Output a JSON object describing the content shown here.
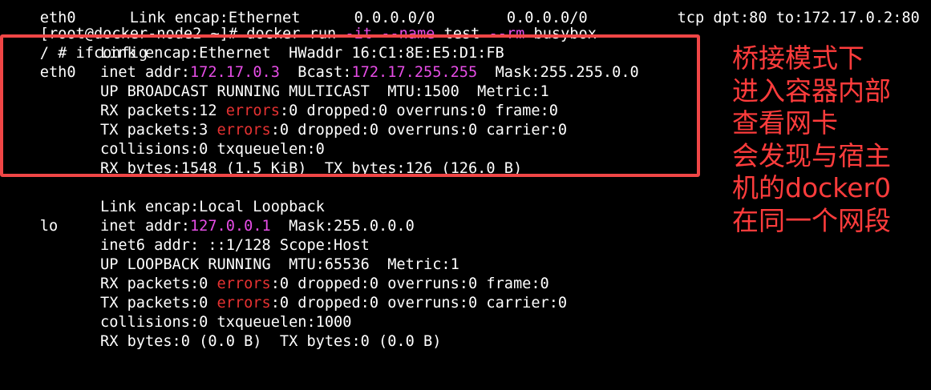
{
  "terminal": {
    "top_cut": "eth0      Link encap:Ethernet      0.0.0.0/0        0.0.0.0/0          tcp dpt:80 to:172.17.0.2:80",
    "prompt_line": {
      "prompt": "[root@docker-node2 ~]# ",
      "cmd1": "docker run ",
      "flag_it": "-it",
      "cmd2": " ",
      "flag_name": "--name",
      "cmd3": " test ",
      "flag_rm": "--rm",
      "cmd4": " busybox"
    },
    "ifconfig_line": "/ # ifconfig",
    "eth0": {
      "iface": "eth0",
      "l1": "Link encap:Ethernet  HWaddr 16:C1:8E:E5:D1:FB",
      "l2a": "inet addr:",
      "ip": "172.17.0.3",
      "l2b": "  Bcast:",
      "bcast": "172.17.255.255",
      "l2c": "  Mask:255.255.0.0",
      "l3": "UP BROADCAST RUNNING MULTICAST  MTU:1500  Metric:1",
      "l4a": "RX packets:12 ",
      "l4err": "errors",
      "l4b": ":0 dropped:0 overruns:0 frame:0",
      "l5a": "TX packets:3 ",
      "l5err": "errors",
      "l5b": ":0 dropped:0 overruns:0 carrier:0",
      "l6": "collisions:0 txqueuelen:0",
      "l7": "RX bytes:1548 (1.5 KiB)  TX bytes:126 (126.0 B)"
    },
    "lo": {
      "iface": "lo",
      "l1": "Link encap:Local Loopback",
      "l2a": "inet addr:",
      "ip": "127.0.0.1",
      "l2b": "  Mask:255.0.0.0",
      "l3": "inet6 addr: ::1/128 Scope:Host",
      "l4": "UP LOOPBACK RUNNING  MTU:65536  Metric:1",
      "l5a": "RX packets:0 ",
      "l5err": "errors",
      "l5b": ":0 dropped:0 overruns:0 frame:0",
      "l6a": "TX packets:0 ",
      "l6err": "errors",
      "l6b": ":0 dropped:0 overruns:0 carrier:0",
      "l7": "collisions:0 txqueuelen:1000",
      "l8": "RX bytes:0 (0.0 B)  TX bytes:0 (0.0 B)"
    }
  },
  "annotation": {
    "lines": [
      "桥接模式下",
      "进入容器内部",
      "查看网卡",
      "会发现与宿主",
      "机的docker0",
      "在同一个网段"
    ]
  },
  "colors": {
    "background": "#000000",
    "text": "#ffffff",
    "highlight_ip": "#e64de6",
    "highlight_error": "#e63232",
    "box": "#f04646",
    "note": "#ff3c3c"
  }
}
